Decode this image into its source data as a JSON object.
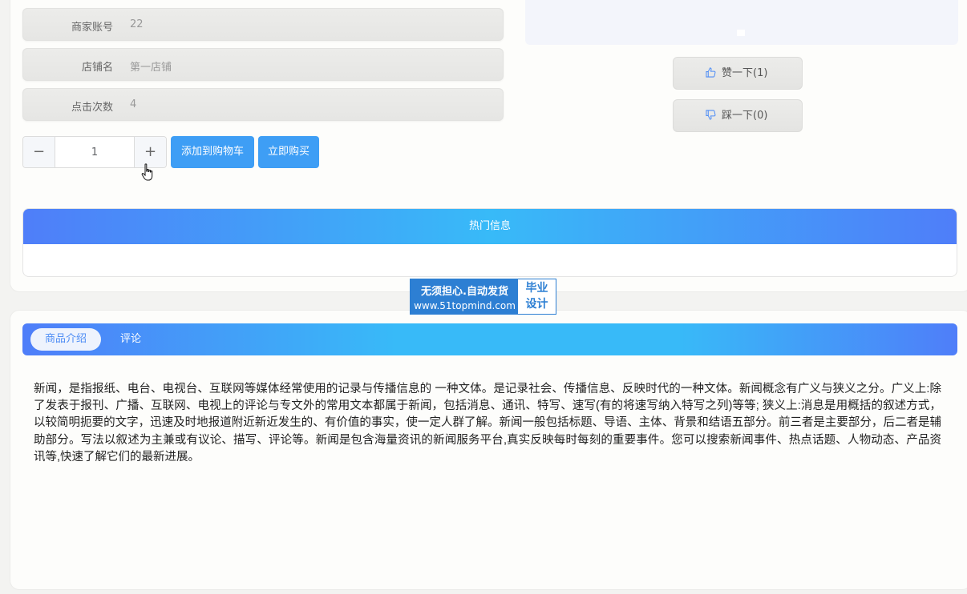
{
  "product_info": {
    "rows": [
      {
        "label": "商家账号",
        "value": "22"
      },
      {
        "label": "店铺名",
        "value": "第一店铺"
      },
      {
        "label": "点击次数",
        "value": "4"
      }
    ]
  },
  "quantity": {
    "minus": "−",
    "value": "1",
    "plus": "+"
  },
  "actions": {
    "add_to_cart": "添加到购物车",
    "buy_now": "立即购买"
  },
  "votes": {
    "like": "赞一下(1)",
    "dislike": "踩一下(0)"
  },
  "hot_info": {
    "title": "热门信息"
  },
  "watermark": {
    "line1": "无须担心.自动发货",
    "line2": "www.51topmind.com",
    "side1": "毕业",
    "side2": "设计"
  },
  "tabs": {
    "intro": "商品介绍",
    "comment": "评论"
  },
  "description": "新闻，是指报纸、电台、电视台、互联网等媒体经常使用的记录与传播信息的 一种文体。是记录社会、传播信息、反映时代的一种文体。新闻概念有广义与狭义之分。广义上:除了发表于报刊、广播、互联网、电视上的评论与专文外的常用文本都属于新闻，包括消息、通讯、特写、速写(有的将速写纳入特写之列)等等; 狭义上:消息是用概括的叙述方式，以较简明扼要的文字，迅速及时地报道附近新近发生的、有价值的事实，使一定人群了解。新闻一般包括标题、导语、主体、背景和结语五部分。前三者是主要部分，后二者是辅助部分。写法以叙述为主兼或有议论、描写、评论等。新闻是包含海量资讯的新闻服务平台,真实反映每时每刻的重要事件。您可以搜索新闻事件、热点话题、人物动态、产品资讯等,快速了解它们的最新进展。",
  "colors": {
    "primary": "#3e9ef5",
    "gradient_start": "#4f7ef9",
    "gradient_mid": "#38baf8",
    "watermark": "#2d7fd3"
  },
  "icons": {
    "like": "thumbs-up-icon",
    "dislike": "thumbs-down-icon",
    "cursor": "hand-pointer-icon"
  }
}
